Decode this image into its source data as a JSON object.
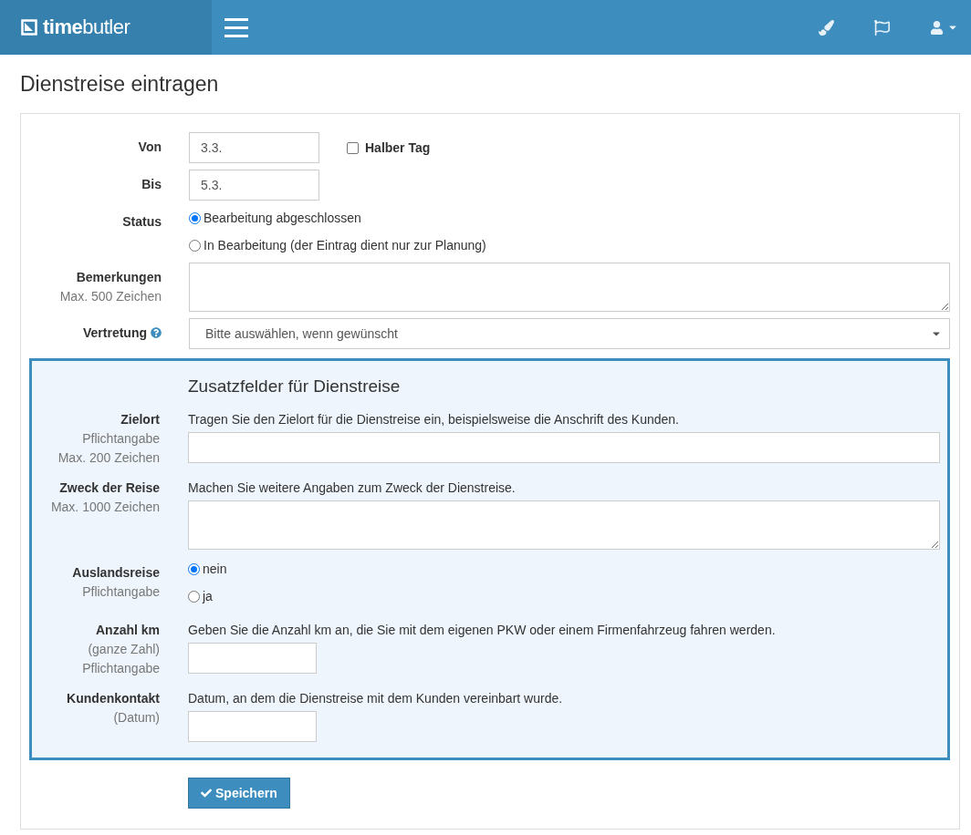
{
  "header": {
    "logo": "**time**butler"
  },
  "page_title": "Dienstreise eintragen",
  "form_rows": [
    {
      "kind": "date",
      "label": "Von",
      "value": "3.3.",
      "checkbox": {
        "label": "Halber Tag",
        "checked": false
      }
    },
    {
      "kind": "date",
      "label": "Bis",
      "value": "5.3."
    },
    {
      "kind": "radio",
      "label": "Status",
      "options": [
        {
          "label": "Bearbeitung abgeschlossen",
          "selected": true
        },
        {
          "label": "In Bearbeitung (der Eintrag dient nur zur Planung)",
          "selected": false
        }
      ]
    },
    {
      "kind": "textarea",
      "label": "Bemerkungen",
      "hints": [
        "Max. 500 Zeichen"
      ]
    },
    {
      "kind": "select",
      "label": "Vertretung",
      "help": true,
      "value": "Bitte auswählen, wenn gewünscht"
    }
  ],
  "extra": {
    "title": "Zusatzfelder für Dienstreise",
    "rows": [
      {
        "kind": "text",
        "label": "Zielort",
        "hints": [
          "Pflichtangabe",
          "Max. 200 Zeichen"
        ],
        "description": "Tragen Sie den Zielort für die Dienstreise ein, beispielsweise die Anschrift des Kunden."
      },
      {
        "kind": "textarea",
        "label": "Zweck der Reise",
        "hints": [
          "Max. 1000 Zeichen"
        ],
        "description": "Machen Sie weitere Angaben zum Zweck der Dienstreise."
      },
      {
        "kind": "radio",
        "label": "Auslandsreise",
        "hints": [
          "Pflichtangabe"
        ],
        "options": [
          {
            "label": "nein",
            "selected": true
          },
          {
            "label": "ja",
            "selected": false
          }
        ]
      },
      {
        "kind": "short",
        "label": "Anzahl km",
        "hints": [
          "(ganze Zahl)",
          "Pflichtangabe"
        ],
        "description": "Geben Sie die Anzahl km an, die Sie mit dem eigenen PKW oder einem Firmenfahrzeug fahren werden."
      },
      {
        "kind": "short",
        "label": "Kundenkontakt",
        "hints": [
          "(Datum)"
        ],
        "description": "Datum, an dem die Dienstreise mit dem Kunden vereinbart wurde."
      }
    ]
  },
  "save_button": "Speichern"
}
